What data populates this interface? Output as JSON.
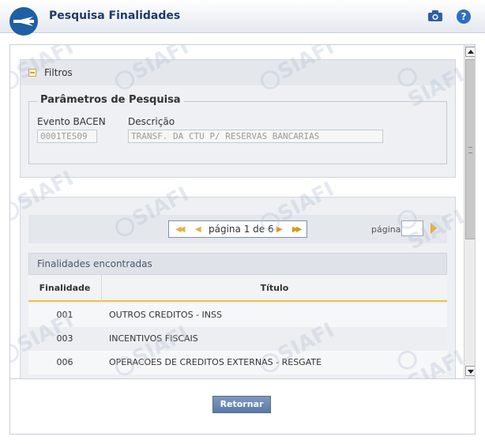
{
  "header": {
    "title": "Pesquisa Finalidades",
    "camera_icon": "camera-icon",
    "help_glyph": "?"
  },
  "filtros": {
    "label": "Filtros",
    "fieldset_legend": "Parâmetros de Pesquisa",
    "evento_label": "Evento BACEN",
    "evento_value": "0001TES09",
    "descricao_label": "Descrição",
    "descricao_value": "TRANSF. DA CTU P/ RESERVAS BANCARIAS"
  },
  "pager": {
    "text": "página 1 de 6",
    "page_label": "página",
    "page_input_value": ""
  },
  "grid": {
    "title": "Finalidades encontradas",
    "col_finalidade": "Finalidade",
    "col_titulo": "Título",
    "rows": [
      {
        "code": "001",
        "title": "OUTROS CREDITOS - INSS"
      },
      {
        "code": "003",
        "title": "INCENTIVOS FISCAIS"
      },
      {
        "code": "006",
        "title": "OPERACOES DE CREDITOS EXTERNAS - RESGATE"
      }
    ]
  },
  "footer": {
    "retornar_label": "Retornar"
  },
  "watermark": "SIAFI",
  "colors": {
    "header_title": "#1d3a66",
    "accent_gold": "#f0a81a",
    "button_blue": "#5a7aa6"
  }
}
